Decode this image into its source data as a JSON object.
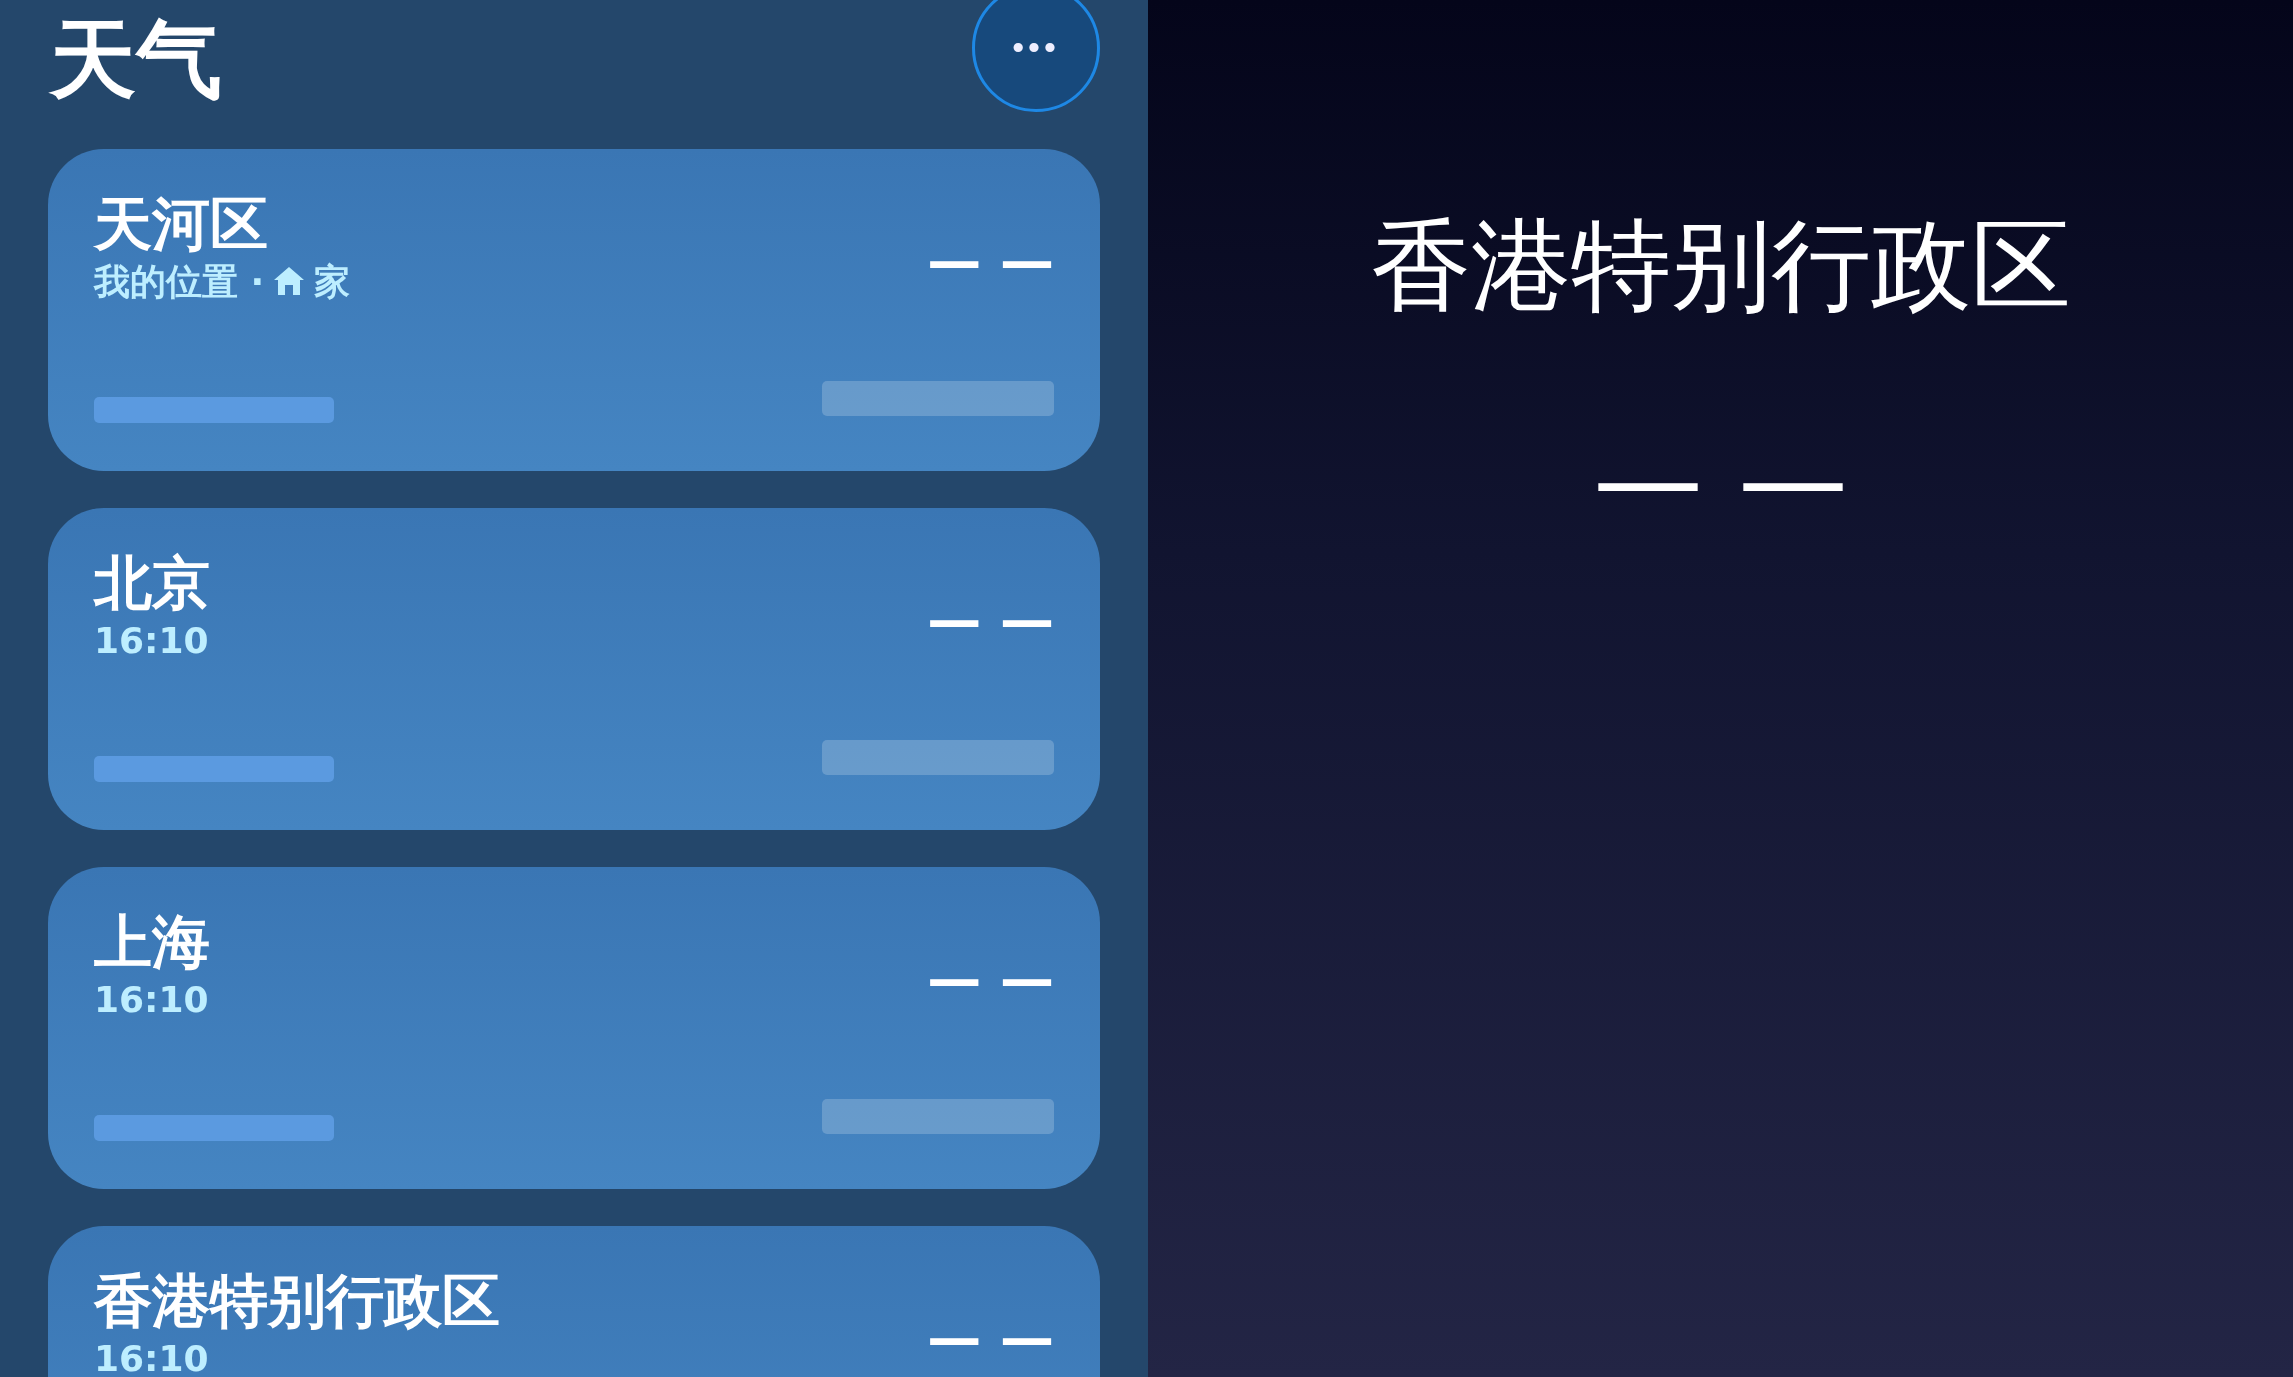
{
  "sidebar": {
    "title": "天气",
    "more_button": {
      "label": "•••"
    },
    "locations": [
      {
        "kind": "current",
        "name": "天河区",
        "subtitle": "我的位置 ·",
        "home_label": "家",
        "temperature": "— —"
      },
      {
        "kind": "city",
        "name": "北京",
        "subtitle": "16:10",
        "temperature": "— —"
      },
      {
        "kind": "city",
        "name": "上海",
        "subtitle": "16:10",
        "temperature": "— —"
      },
      {
        "kind": "city",
        "name": "香港特别行政区",
        "subtitle": "16:10",
        "temperature": "— —"
      }
    ]
  },
  "detail": {
    "location": "香港特别行政区",
    "temperature": "— —"
  }
}
